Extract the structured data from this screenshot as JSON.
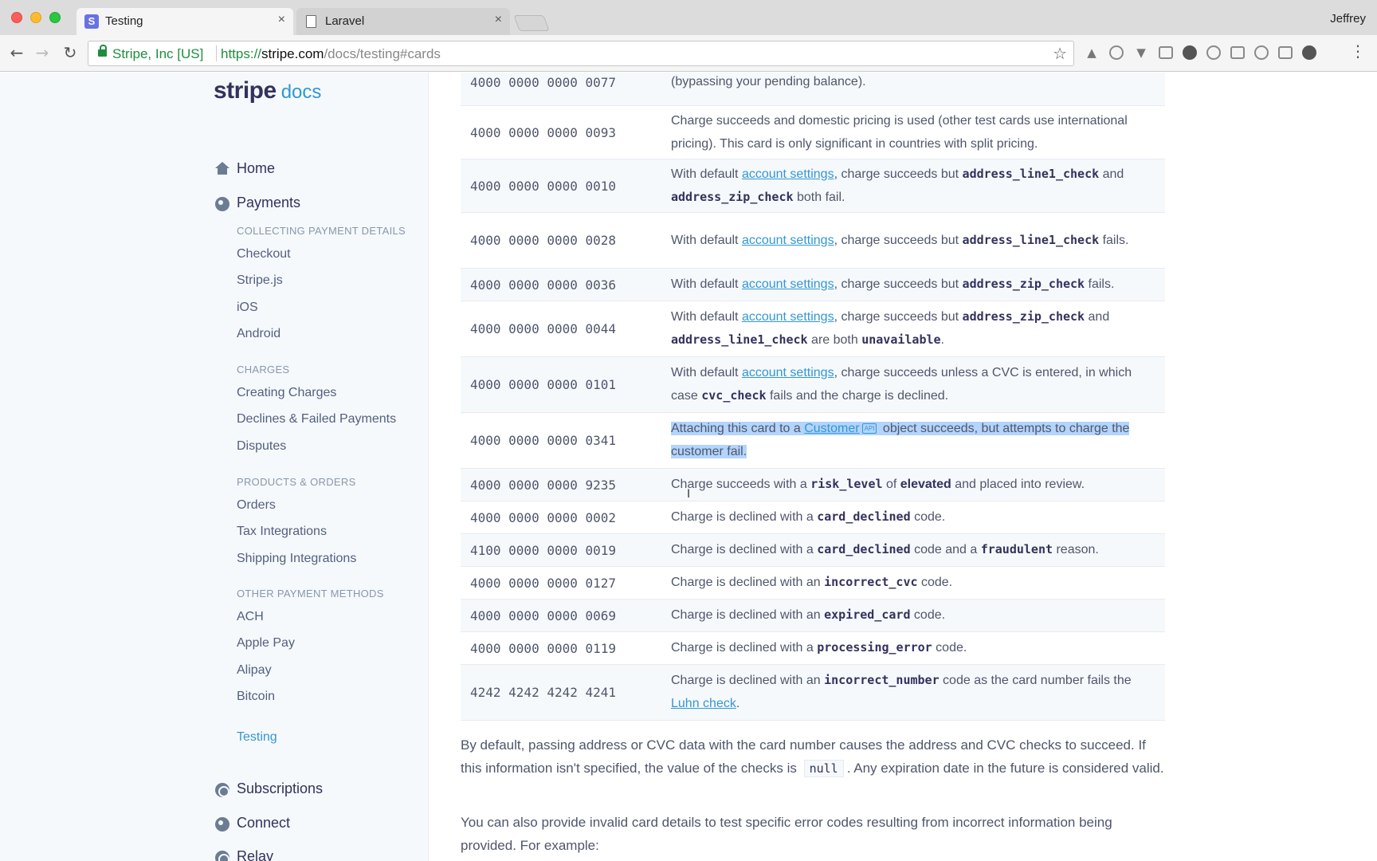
{
  "browser": {
    "tabs": [
      {
        "title": "Testing",
        "active": true,
        "favicon": "stripe-favicon"
      },
      {
        "title": "Laravel",
        "active": false,
        "favicon": "document-icon"
      }
    ],
    "close_glyph": "×",
    "profile_name": "Jeffrey",
    "address_bar": {
      "ev_label": "Stripe, Inc [US]",
      "url_scheme": "https://",
      "url_host": "stripe.com",
      "url_path": "/docs/testing#cards"
    }
  },
  "sidebar": {
    "logo": {
      "brand": "stripe",
      "suffix": "docs"
    },
    "top_items": [
      {
        "label": "Home",
        "icon": "home-icon"
      },
      {
        "label": "Payments",
        "icon": "globe-icon"
      }
    ],
    "sections": [
      {
        "heading": "COLLECTING PAYMENT DETAILS",
        "items": [
          "Checkout",
          "Stripe.js",
          "iOS",
          "Android"
        ]
      },
      {
        "heading": "CHARGES",
        "items": [
          "Creating Charges",
          "Declines & Failed Payments",
          "Disputes"
        ]
      },
      {
        "heading": "PRODUCTS & ORDERS",
        "items": [
          "Orders",
          "Tax Integrations",
          "Shipping Integrations"
        ]
      },
      {
        "heading": "OTHER PAYMENT METHODS",
        "items": [
          "ACH",
          "Apple Pay",
          "Alipay",
          "Bitcoin"
        ]
      }
    ],
    "active_item": "Testing",
    "bottom_items": [
      {
        "label": "Subscriptions",
        "icon": "subscriptions-icon"
      },
      {
        "label": "Connect",
        "icon": "connect-icon"
      },
      {
        "label": "Relay",
        "icon": "relay-icon"
      }
    ]
  },
  "cards_table": {
    "rows": [
      {
        "number": "4000 0000 0000 0077",
        "text": "(bypassing your pending balance)."
      },
      {
        "number": "4000 0000 0000 0093",
        "text": "Charge succeeds and domestic pricing is used (other test cards use international pricing). This card is only significant in countries with split pricing."
      },
      {
        "number": "4000 0000 0000 0010",
        "pre": "With default ",
        "link": "account settings",
        "mid": ", charge succeeds but ",
        "code1": "address_line1_check",
        "mid2": " and ",
        "code2": "address_zip_check",
        "post": " both fail."
      },
      {
        "number": "4000 0000 0000 0028",
        "pre": "With default ",
        "link": "account settings",
        "mid": ", charge succeeds but ",
        "code1": "address_line1_check",
        "post": " fails."
      },
      {
        "number": "4000 0000 0000 0036",
        "pre": "With default ",
        "link": "account settings",
        "mid": ", charge succeeds but ",
        "code1": "address_zip_check",
        "post": " fails."
      },
      {
        "number": "4000 0000 0000 0044",
        "pre": "With default ",
        "link": "account settings",
        "mid": ", charge succeeds but ",
        "code1": "address_zip_check",
        "mid2": " and ",
        "code2": "address_line1_check",
        "mid3": " are both ",
        "code3": "unavailable",
        "post": "."
      },
      {
        "number": "4000 0000 0000 0101",
        "pre": "With default ",
        "link": "account settings",
        "mid": ", charge succeeds unless a CVC is entered, in which case ",
        "code1": "cvc_check",
        "post": " fails and the charge is declined."
      },
      {
        "number": "4000 0000 0000 0341",
        "pre": "Attaching this card to a ",
        "link": "Customer",
        "badge": "API",
        "post": " object succeeds, but attempts to charge the customer fail."
      },
      {
        "number": "4000 0000 0000 9235",
        "pre": "Charge succeeds with a ",
        "code1": "risk_level",
        "mid": " of ",
        "strong": "elevated",
        "post": " and placed into review."
      },
      {
        "number": "4000 0000 0000 0002",
        "pre": "Charge is declined with a ",
        "code1": "card_declined",
        "post": " code."
      },
      {
        "number": "4100 0000 0000 0019",
        "pre": "Charge is declined with a ",
        "code1": "card_declined",
        "mid": " code and a ",
        "code2": "fraudulent",
        "post": " reason."
      },
      {
        "number": "4000 0000 0000 0127",
        "pre": "Charge is declined with an ",
        "code1": "incorrect_cvc",
        "post": " code."
      },
      {
        "number": "4000 0000 0000 0069",
        "pre": "Charge is declined with an ",
        "code1": "expired_card",
        "post": " code."
      },
      {
        "number": "4000 0000 0000 0119",
        "pre": "Charge is declined with a ",
        "code1": "processing_error",
        "post": " code."
      },
      {
        "number": "4242 4242 4242 4241",
        "pre": "Charge is declined with an ",
        "code1": "incorrect_number",
        "mid": " code as the card number fails the ",
        "link": "Luhn check",
        "post": "."
      }
    ]
  },
  "paragraphs": {
    "p1_pre": "By default, passing address or CVC data with the card number causes the address and CVC checks to succeed. If this information isn't specified, the value of the checks is",
    "p1_code": "null",
    "p1_post": ". Any expiration date in the future is considered valid.",
    "p2": "You can also provide invalid card details to test specific error codes resulting from incorrect information being provided. For example:"
  },
  "colors": {
    "accent": "#3297d3",
    "selection": "#b3d4fc",
    "sidebar_bg": "#f6f9fc"
  }
}
